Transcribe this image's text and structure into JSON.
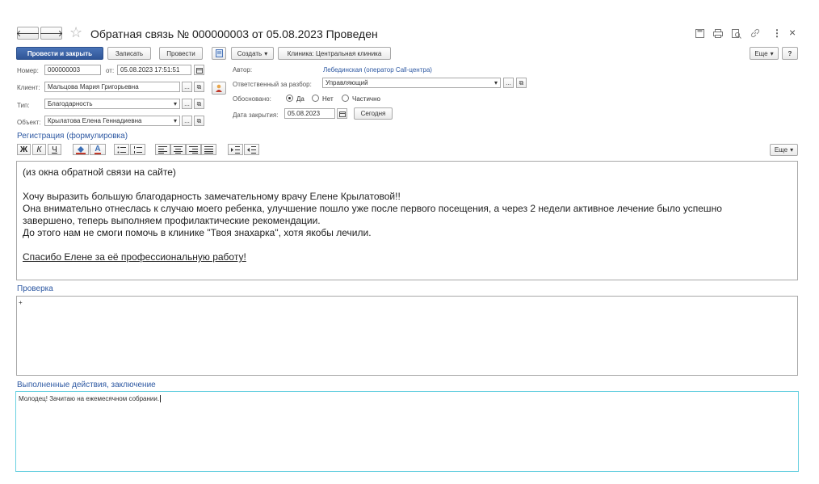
{
  "title": "Обратная связь № 000000003 от 05.08.2023 Проведен",
  "header": {
    "back_glyph": "🡐",
    "fwd_glyph": "🡒",
    "star_glyph": "☆",
    "close_glyph": "×",
    "more_glyph": "⋮"
  },
  "toolbar": {
    "post_and_close": "Провести и закрыть",
    "save": "Записать",
    "post": "Провести",
    "create": "Создать",
    "clinic": "Клиника: Центральная клиника",
    "more": "Еще",
    "help": "?"
  },
  "form": {
    "number_label": "Номер:",
    "number_value": "000000003",
    "date_label": "от:",
    "date_value": "05.08.2023 17:51:51",
    "client_label": "Клиент:",
    "client_value": "Мальцова Мария Григорьевна",
    "type_label": "Тип:",
    "type_value": "Благодарность",
    "object_label": "Объект:",
    "object_value": "Крылатова Елена Геннадиевна",
    "author_label": "Автор:",
    "author_value": "Лебединская (оператор Call-центра)",
    "responsible_label": "Ответственный за разбор:",
    "responsible_value": "Управляющий",
    "justified_label": "Обосновано:",
    "justified_options": [
      "Да",
      "Нет",
      "Частично"
    ],
    "justified_selected": "Да",
    "close_date_label": "Дата закрытия:",
    "close_date_value": "05.08.2023",
    "today_button": "Сегодня",
    "ellipsis": "...",
    "open_glyph": "⧉",
    "dropdown_glyph": "▾"
  },
  "registration": {
    "title": "Регистрация (формулировка)",
    "format": {
      "bold": "Ж",
      "italic": "К",
      "underline": "Ч",
      "font_color": "A"
    },
    "more": "Еще",
    "lines": [
      "(из окна обратной связи на сайте)",
      "",
      "Хочу выразить большую благодарность замечательному врачу Елене Крылатовой!!",
      "Она внимательно отнеслась к случаю моего ребенка, улучшение пошло уже после первого посещения, а через 2 недели активное лечение было успешно",
      "завершено, теперь выполняем профилактические рекомендации.",
      "До этого нам не смоги помочь в клинике \"Твоя знахарка\", хотя якобы лечили.",
      "",
      "Спасибо Елене за её профессиональную работу!"
    ]
  },
  "check": {
    "title": "Проверка",
    "text": "+"
  },
  "actions": {
    "title": "Выполненные действия, заключение",
    "text": "Молодец! Зачитаю на ежемесячном собрании."
  },
  "colors": {
    "accent": "#2f5597",
    "section": "#2d58a2",
    "focus": "#6ad0e0",
    "link": "#2d58a2"
  }
}
